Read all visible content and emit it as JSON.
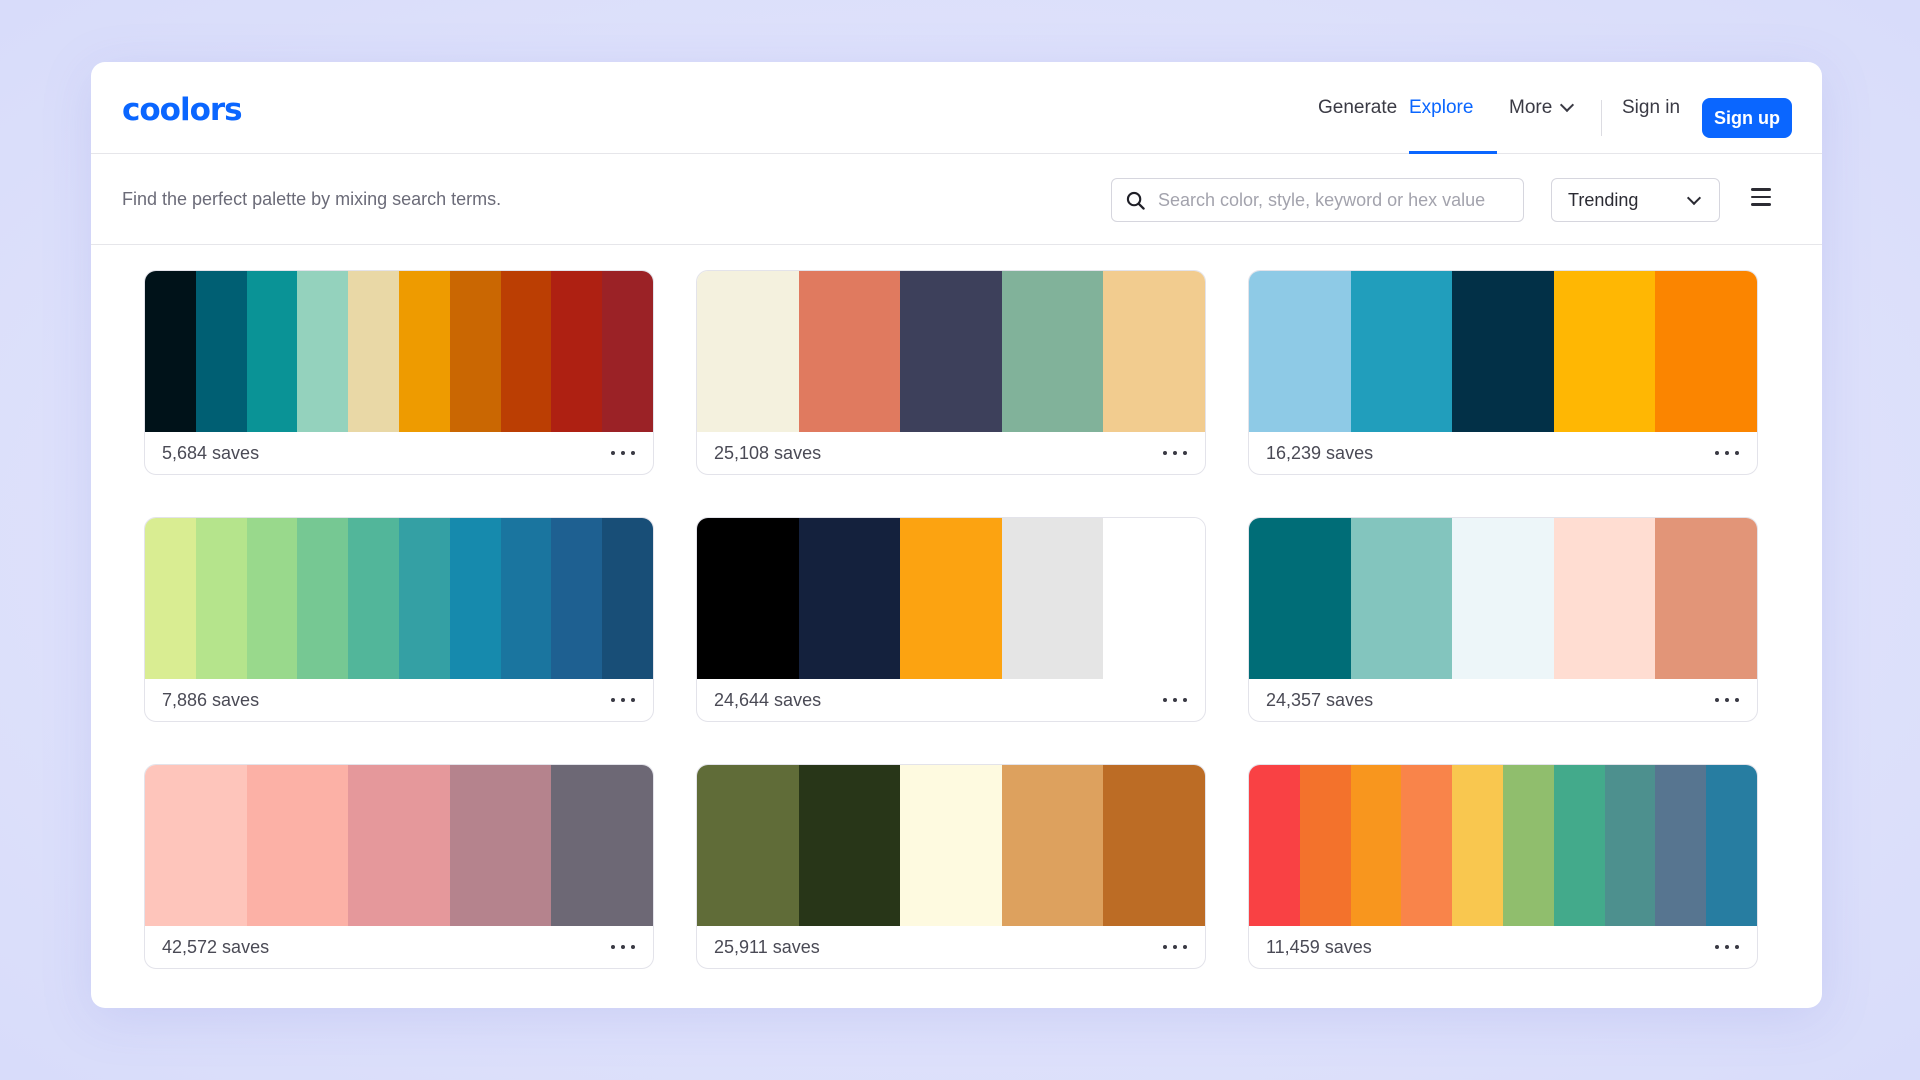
{
  "app": {
    "logo": "coolors"
  },
  "nav": {
    "generate": "Generate",
    "explore": "Explore",
    "more": "More",
    "sign_in": "Sign in",
    "sign_up": "Sign up"
  },
  "explore": {
    "tagline": "Find the perfect palette by mixing search terms.",
    "search_placeholder": "Search color, style, keyword or hex value",
    "sort_value": "Trending"
  },
  "palettes": [
    {
      "saves": "5,684 saves",
      "colors": [
        "#001219",
        "#005f73",
        "#0a9396",
        "#94d2bd",
        "#e9d8a6",
        "#ee9b00",
        "#ca6702",
        "#bb3e03",
        "#ae2012",
        "#9b2226"
      ]
    },
    {
      "saves": "25,108 saves",
      "colors": [
        "#f4f1de",
        "#e07a5f",
        "#3d405b",
        "#81b29a",
        "#f2cc8f"
      ]
    },
    {
      "saves": "16,239 saves",
      "colors": [
        "#8ecae6",
        "#219ebc",
        "#023047",
        "#ffb703",
        "#fb8500"
      ]
    },
    {
      "saves": "7,886 saves",
      "colors": [
        "#d9ed92",
        "#b5e48c",
        "#99d98c",
        "#76c893",
        "#52b69a",
        "#34a0a4",
        "#168aad",
        "#1a759f",
        "#1e6091",
        "#184e77"
      ]
    },
    {
      "saves": "24,644 saves",
      "colors": [
        "#000000",
        "#14213d",
        "#fca311",
        "#e5e5e5",
        "#ffffff"
      ]
    },
    {
      "saves": "24,357 saves",
      "colors": [
        "#006d77",
        "#83c5be",
        "#edf6f9",
        "#ffddd2",
        "#e29578"
      ]
    },
    {
      "saves": "42,572 saves",
      "colors": [
        "#fec5bb",
        "#fcb1a6",
        "#e5989b",
        "#b5838d",
        "#6d6875"
      ]
    },
    {
      "saves": "25,911 saves",
      "colors": [
        "#606c38",
        "#283618",
        "#fefae0",
        "#dda15e",
        "#bc6c25"
      ]
    },
    {
      "saves": "11,459 saves",
      "colors": [
        "#f94144",
        "#f3722c",
        "#f8961e",
        "#f9844a",
        "#f9c74f",
        "#90be6d",
        "#43aa8b",
        "#4d908e",
        "#577590",
        "#277da1"
      ]
    }
  ]
}
